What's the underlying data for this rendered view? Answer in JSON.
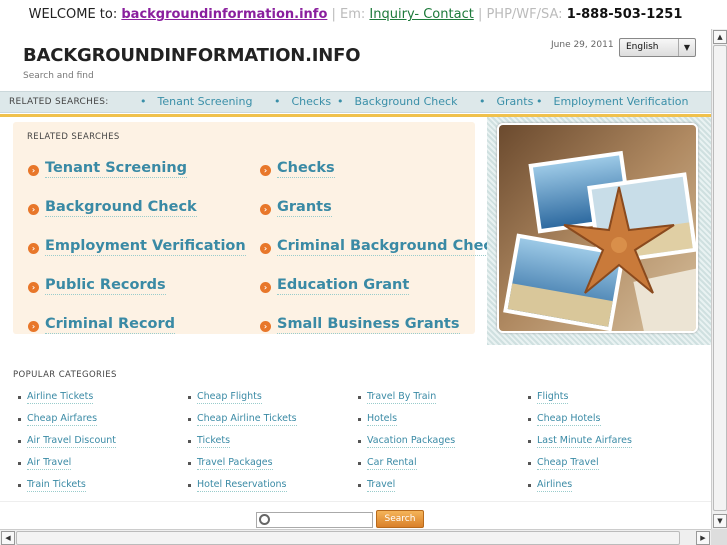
{
  "topbar": {
    "welcome": "WELCOME to: ",
    "domain": "backgroundinformation.info",
    "sep1": " | ",
    "em_label": "Em: ",
    "inquiry": "Inquiry- Contact",
    "sep2": " | ",
    "phone_label": "PHP/WF/SA: ",
    "phone": "1-888-503-1251"
  },
  "header": {
    "title": "BACKGROUNDINFORMATION.INFO",
    "subtitle": "Search and find",
    "date": "June 29, 2011",
    "language": "English"
  },
  "related_bar": {
    "label": "RELATED SEARCHES:",
    "items": [
      "Tenant Screening",
      "Checks",
      "Background Check",
      "Grants",
      "Employment Verification"
    ]
  },
  "related_panel": {
    "heading": "RELATED SEARCHES",
    "left": [
      "Tenant Screening",
      "Background Check",
      "Employment Verification",
      "Public Records",
      "Criminal Record"
    ],
    "right": [
      "Checks",
      "Grants",
      "Criminal Background Check",
      "Education Grant",
      "Small Business Grants"
    ]
  },
  "popular": {
    "heading": "POPULAR CATEGORIES",
    "columns": [
      [
        "Airline Tickets",
        "Cheap Airfares",
        "Air Travel Discount",
        "Air Travel",
        "Train Tickets"
      ],
      [
        "Cheap Flights",
        "Cheap Airline Tickets",
        "Tickets",
        "Travel Packages",
        "Hotel Reservations"
      ],
      [
        "Travel By Train",
        "Hotels",
        "Vacation Packages",
        "Car Rental",
        "Travel"
      ],
      [
        "Flights",
        "Cheap Hotels",
        "Last Minute Airfares",
        "Cheap Travel",
        "Airlines"
      ]
    ]
  },
  "search": {
    "placeholder": "",
    "button": "Search"
  },
  "icons": {
    "arrow": "arrow-circle-icon",
    "search": "magnifier-icon"
  },
  "colors": {
    "accent_orange": "#f0c14c",
    "link_blue": "#3a8aa5",
    "panel_bg": "#fdf2e4"
  }
}
